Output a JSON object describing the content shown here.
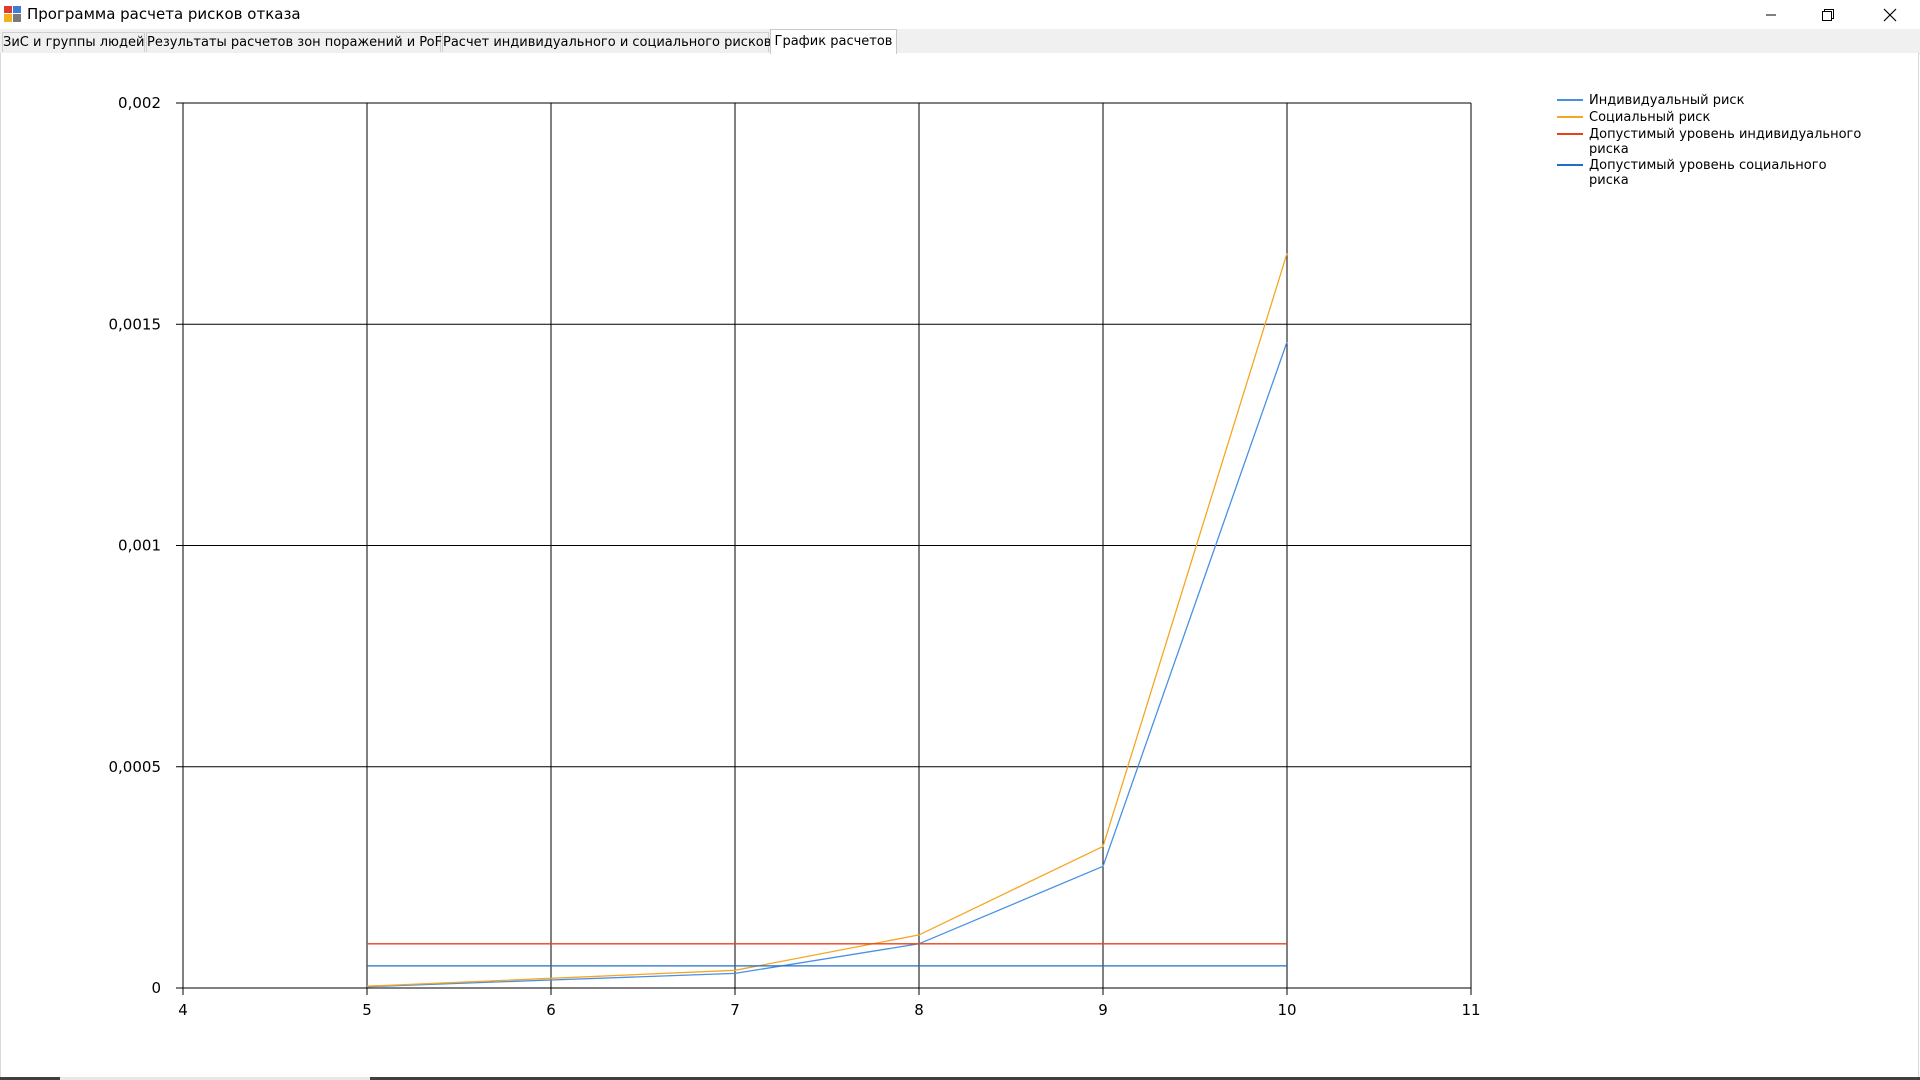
{
  "window": {
    "title": "Программа расчета рисков отказа",
    "controls": [
      "minimize",
      "maximize",
      "close"
    ]
  },
  "tabs": [
    {
      "label": "ЗиС и группы людей",
      "active": false
    },
    {
      "label": "Результаты расчетов зон поражений и PoF",
      "active": false
    },
    {
      "label": "Расчет индивидуального и социального рисков",
      "active": false
    },
    {
      "label": "График расчетов",
      "active": true
    }
  ],
  "chart_data": {
    "type": "line",
    "xlim": [
      4,
      11
    ],
    "ylim": [
      0,
      0.002
    ],
    "x_ticks": [
      "4",
      "5",
      "6",
      "7",
      "8",
      "9",
      "10",
      "11"
    ],
    "y_ticks": [
      "0",
      "0,0005",
      "0,001",
      "0,0015",
      "0,002"
    ],
    "grid": true,
    "legend_position": "top-right",
    "series": [
      {
        "name": "Индивидуальный риск",
        "color": "#4a90e2",
        "x": [
          5,
          6,
          7,
          8,
          9,
          10
        ],
        "y": [
          3e-06,
          1.8e-05,
          3.3e-05,
          0.0001,
          0.000275,
          0.00146
        ]
      },
      {
        "name": "Социальный риск",
        "color": "#f5a623",
        "x": [
          5,
          6,
          7,
          8,
          9,
          10
        ],
        "y": [
          4e-06,
          2.2e-05,
          4e-05,
          0.00012,
          0.00032,
          0.00166
        ]
      },
      {
        "name": "Допустимый уровень индивидуального риска",
        "color": "#e8401c",
        "x": [
          5,
          10
        ],
        "y": [
          0.0001,
          0.0001
        ]
      },
      {
        "name": "Допустимый уровень социального риска",
        "color": "#1f6fc6",
        "x": [
          5,
          10
        ],
        "y": [
          5e-05,
          5e-05
        ]
      }
    ]
  }
}
